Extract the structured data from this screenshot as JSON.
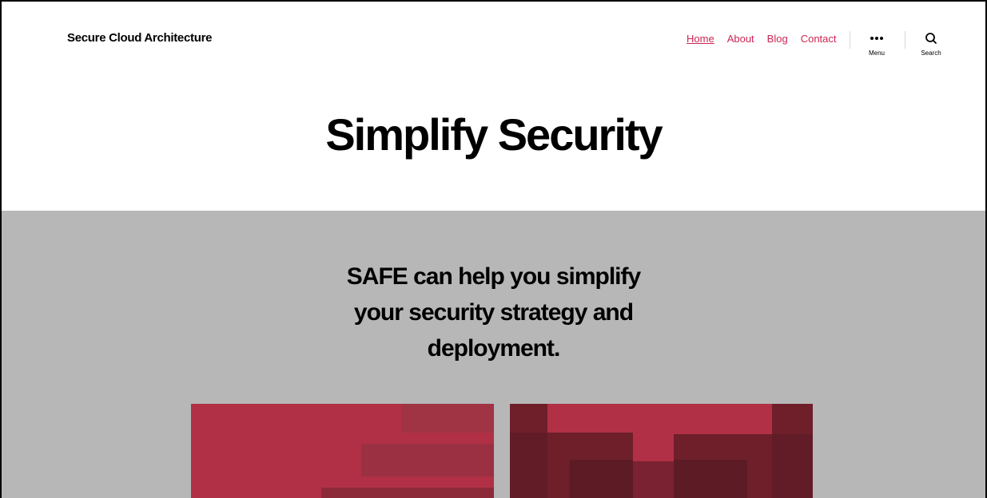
{
  "site": {
    "title": "Secure Cloud Architecture"
  },
  "nav": {
    "items": [
      {
        "label": "Home",
        "current": true
      },
      {
        "label": "About",
        "current": false
      },
      {
        "label": "Blog",
        "current": false
      },
      {
        "label": "Contact",
        "current": false
      }
    ],
    "menu_label": "Menu",
    "search_label": "Search"
  },
  "hero": {
    "title": "Simplify Security"
  },
  "section": {
    "lead_lines": [
      "SAFE can help you simplify",
      "your security strategy and",
      "deployment."
    ]
  },
  "colors": {
    "accent": "#cd2653",
    "band": "#b7b7b7",
    "card_base": "#b13045",
    "card_dark": "#6e1f2a",
    "card_darker": "#5c1b25"
  },
  "icons": {
    "menu": "more-dots-icon",
    "search": "search-icon"
  }
}
